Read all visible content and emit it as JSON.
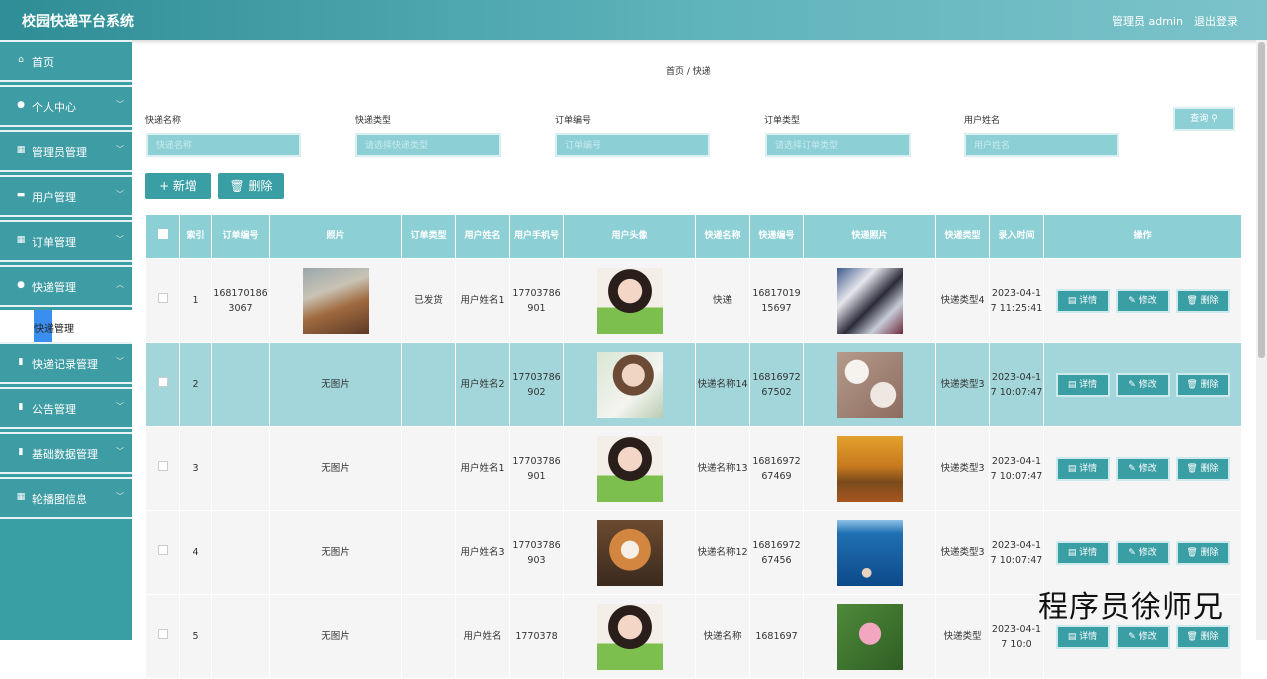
{
  "header": {
    "title": "校园快递平台系统",
    "user": "管理员 admin",
    "logout": "退出登录"
  },
  "menu": [
    {
      "icon": "home-icon",
      "glyph": "⌂",
      "label": "首页"
    },
    {
      "icon": "user-icon",
      "glyph": "●",
      "label": "个人中心"
    },
    {
      "icon": "grid-icon",
      "glyph": "▦",
      "label": "管理员管理"
    },
    {
      "icon": "users-icon",
      "glyph": "▬",
      "label": "用户管理"
    },
    {
      "icon": "grid-icon",
      "glyph": "▦",
      "label": "订单管理"
    },
    {
      "icon": "location-icon",
      "glyph": "●",
      "label": "快递管理"
    },
    {
      "icon": "doc-icon",
      "glyph": "▮",
      "label": "快递记录管理"
    },
    {
      "icon": "doc-icon",
      "glyph": "▮",
      "label": "公告管理"
    },
    {
      "icon": "doc-icon",
      "glyph": "▮",
      "label": "基础数据管理"
    },
    {
      "icon": "grid-icon",
      "glyph": "▦",
      "label": "轮播图信息"
    }
  ],
  "submenu": {
    "label": "快递管理"
  },
  "breadcrumb": "首页 / 快递",
  "filters": [
    {
      "label": "快递名称",
      "placeholder": "快递名称"
    },
    {
      "label": "快递类型",
      "placeholder": "请选择快递类型"
    },
    {
      "label": "订单编号",
      "placeholder": "订单编号"
    },
    {
      "label": "订单类型",
      "placeholder": "请选择订单类型"
    },
    {
      "label": "用户姓名",
      "placeholder": "用户姓名"
    }
  ],
  "query_button": "查询 ⚲",
  "actions": {
    "add": "+ 新增",
    "delete": "🗑 删除"
  },
  "columns": [
    "",
    "索引",
    "订单编号",
    "照片",
    "订单类型",
    "用户姓名",
    "用户手机号",
    "用户头像",
    "快递名称",
    "快递编号",
    "快递照片",
    "快递类型",
    "录入时间",
    "操作"
  ],
  "rows": [
    {
      "index": "1",
      "order_no": "1681701863067",
      "photo": "",
      "order_type": "已发货",
      "user_name": "用户姓名1",
      "phone": "17703786901",
      "express_name": "快递",
      "express_no": "1681701915697",
      "express_type": "快递类型4",
      "time": "2023-04-17 11:25:41"
    },
    {
      "index": "2",
      "order_no": "",
      "photo": "无图片",
      "order_type": "",
      "user_name": "用户姓名2",
      "phone": "17703786902",
      "express_name": "快递名称14",
      "express_no": "1681697267502",
      "express_type": "快递类型3",
      "time": "2023-04-17 10:07:47"
    },
    {
      "index": "3",
      "order_no": "",
      "photo": "无图片",
      "order_type": "",
      "user_name": "用户姓名1",
      "phone": "17703786901",
      "express_name": "快递名称13",
      "express_no": "1681697267469",
      "express_type": "快递类型3",
      "time": "2023-04-17 10:07:47"
    },
    {
      "index": "4",
      "order_no": "",
      "photo": "无图片",
      "order_type": "",
      "user_name": "用户姓名3",
      "phone": "17703786903",
      "express_name": "快递名称12",
      "express_no": "1681697267456",
      "express_type": "快递类型3",
      "time": "2023-04-17 10:07:47"
    },
    {
      "index": "5",
      "order_no": "",
      "photo": "无图片",
      "order_type": "",
      "user_name": "用户姓名",
      "phone": "1770378",
      "express_name": "快递名称",
      "express_no": "1681697",
      "express_type": "快递类型",
      "time": "2023-04-17 10:0"
    }
  ],
  "row_actions": {
    "detail": "▤ 详情",
    "edit": "✎ 修改",
    "remove": "🗑 删除"
  },
  "watermark": "程序员徐师兄"
}
